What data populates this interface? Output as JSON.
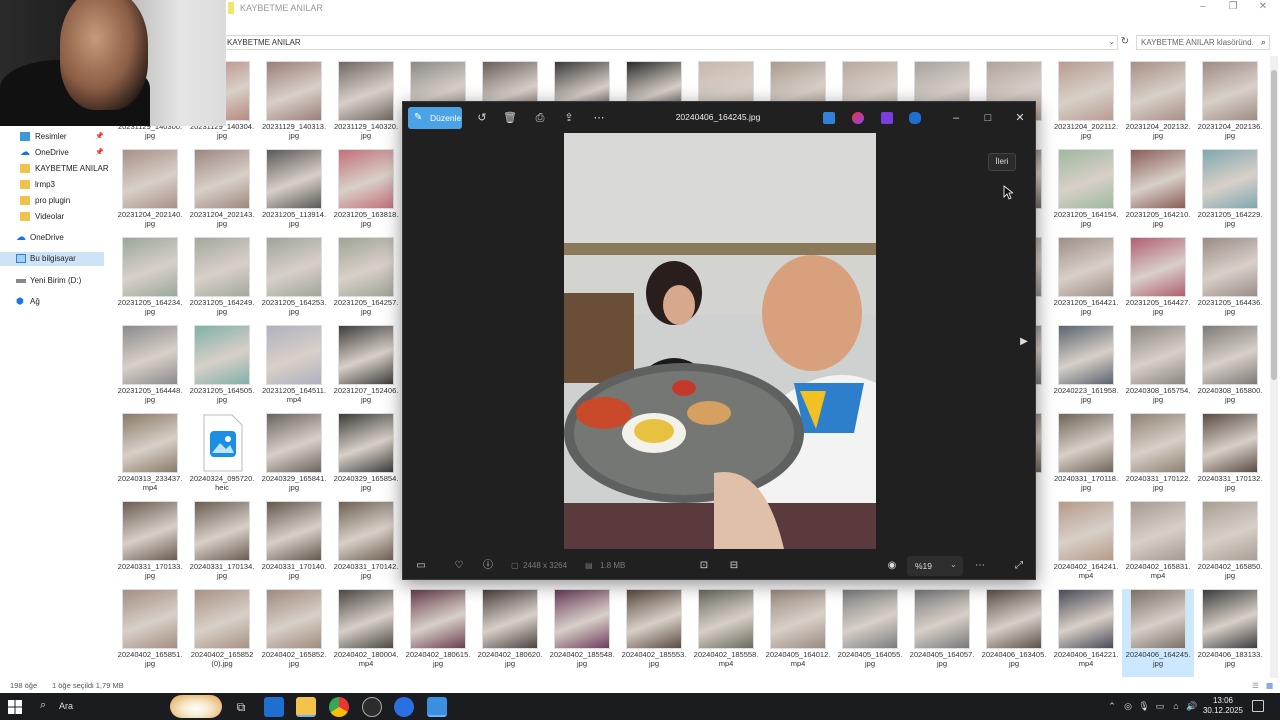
{
  "explorer": {
    "title": "KAYBETME ANILAR",
    "address": "KAYBETME ANILAR",
    "search_placeholder": "KAYBETME ANILAR klasöründ...",
    "status": {
      "count": "198 öğe",
      "selected": "1 öğe seçildi  1,79 MB"
    }
  },
  "sidebar": {
    "items": [
      {
        "label": "Resimler",
        "icon": "pictures-icon"
      },
      {
        "label": "OneDrive",
        "icon": "onedrive-icon"
      },
      {
        "label": "KAYBETME ANILAR",
        "icon": "folder-icon"
      },
      {
        "label": "lrmp3",
        "icon": "folder-icon"
      },
      {
        "label": "pro plugin",
        "icon": "folder-icon"
      },
      {
        "label": "Videolar",
        "icon": "folder-icon"
      },
      {
        "label": "OneDrive",
        "icon": "onedrive-icon"
      },
      {
        "label": "Bu bilgisayar",
        "icon": "this-pc-icon"
      },
      {
        "label": "Yeni Birim (D:)",
        "icon": "drive-icon"
      },
      {
        "label": "Ağ",
        "icon": "network-icon"
      }
    ]
  },
  "files": {
    "row0": [
      {
        "l1": "20231129_140300.",
        "l2": "jpg",
        "c": "#8a7a70"
      },
      {
        "l1": "20231129_140304.",
        "l2": "jpg",
        "c": "#b58a80"
      },
      {
        "l1": "20231129_140313.",
        "l2": "jpg",
        "c": "#9a7f79"
      },
      {
        "l1": "20231129_140320.",
        "l2": "jpg",
        "c": "#6f6763"
      },
      {
        "l1": "",
        "l2": "",
        "c": "#8d8a88"
      },
      {
        "l1": "",
        "l2": "",
        "c": "#6a5e5a"
      },
      {
        "l1": "",
        "l2": "",
        "c": "#3b3838"
      },
      {
        "l1": "",
        "l2": "",
        "c": "#2a2a2a"
      },
      {
        "l1": "",
        "l2": "",
        "c": "#c9b8ae"
      },
      {
        "l1": "",
        "l2": "",
        "c": "#a99b8f"
      },
      {
        "l1": "",
        "l2": "",
        "c": "#b8a89e"
      },
      {
        "l1": "",
        "l2": "",
        "c": "#a8a3a0"
      },
      {
        "l1": "...08.",
        "l2": "",
        "c": "#b0a39c"
      },
      {
        "l1": "20231204_202112.",
        "l2": "jpg",
        "c": "#b89c92"
      },
      {
        "l1": "20231204_202132.",
        "l2": "jpg",
        "c": "#a88f86"
      },
      {
        "l1": "20231204_202136.",
        "l2": "jpg",
        "c": "#9f8b84"
      }
    ],
    "row1": [
      {
        "l1": "20231204_202140.",
        "l2": "jpg",
        "c": "#a89088"
      },
      {
        "l1": "20231204_202143.",
        "l2": "jpg",
        "c": "#9d8780"
      },
      {
        "l1": "20231205_113914.",
        "l2": "jpg",
        "c": "#5b5858"
      },
      {
        "l1": "20231205_163818.",
        "l2": "jpg",
        "c": "#c2707a"
      },
      {
        "l1": "...01.",
        "l2": "",
        "c": "#6f6a60"
      },
      {
        "l1": "20231205_164154.",
        "l2": "jpg",
        "c": "#9fb8a0"
      },
      {
        "l1": "20231205_164210.",
        "l2": "jpg",
        "c": "#8a5d58"
      },
      {
        "l1": "20231205_164229.",
        "l2": "jpg",
        "c": "#7fa8b0"
      }
    ],
    "row2": [
      {
        "l1": "20231205_164234.",
        "l2": "jpg",
        "c": "#9aa79a"
      },
      {
        "l1": "20231205_164249.",
        "l2": "jpg",
        "c": "#a4a89c"
      },
      {
        "l1": "20231205_164253.",
        "l2": "jpg",
        "c": "#a0a499"
      },
      {
        "l1": "20231205_164257.",
        "l2": "jpg",
        "c": "#9fa396"
      },
      {
        "l1": "...58.",
        "l2": "",
        "c": "#909090"
      },
      {
        "l1": "20231205_164421.",
        "l2": "jpg",
        "c": "#9e8e88"
      },
      {
        "l1": "20231205_164427.",
        "l2": "jpg",
        "c": "#b06070"
      },
      {
        "l1": "20231205_164436.",
        "l2": "jpg",
        "c": "#9a8c86"
      }
    ],
    "row3": [
      {
        "l1": "20231205_164448.",
        "l2": "jpg",
        "c": "#8c8a8c"
      },
      {
        "l1": "20231205_164505.",
        "l2": "jpg",
        "c": "#80b0a8"
      },
      {
        "l1": "20231205_164511.",
        "l2": "mp4",
        "c": "#b0b0c0"
      },
      {
        "l1": "20231207_152406.",
        "l2": "jpg",
        "c": "#3e3c3c"
      },
      {
        "l1": "...55.",
        "l2": "",
        "c": "#777"
      },
      {
        "l1": "20240223_161958.",
        "l2": "jpg",
        "c": "#5a6470"
      },
      {
        "l1": "20240308_165754.",
        "l2": "jpg",
        "c": "#8a8680"
      },
      {
        "l1": "20240308_165800.",
        "l2": "jpg",
        "c": "#7e7a78"
      }
    ],
    "row4": [
      {
        "l1": "20240313_233437.",
        "l2": "mp4",
        "c": "#8a7a68"
      },
      {
        "l1": "20240324_095720.",
        "l2": "heic",
        "c": "file"
      },
      {
        "l1": "20240329_165841.",
        "l2": "jpg",
        "c": "#6a6460"
      },
      {
        "l1": "20240329_165854.",
        "l2": "jpg",
        "c": "#3c3c3a"
      },
      {
        "l1": "...11.",
        "l2": "",
        "c": "#6b6350"
      },
      {
        "l1": "20240331_170118.",
        "l2": "jpg",
        "c": "#6e6658"
      },
      {
        "l1": "20240331_170122.",
        "l2": "jpg",
        "c": "#8d8172"
      },
      {
        "l1": "20240331_170132.",
        "l2": "jpg",
        "c": "#5a4c44"
      }
    ],
    "row5": [
      {
        "l1": "20240331_170133.",
        "l2": "jpg",
        "c": "#6a5c52"
      },
      {
        "l1": "20240331_170134.",
        "l2": "jpg",
        "c": "#6a5d53"
      },
      {
        "l1": "20240331_170140.",
        "l2": "jpg",
        "c": "#64584e"
      },
      {
        "l1": "20240331_170142.",
        "l2": "jpg",
        "c": "#6f6155"
      },
      {
        "l1": "20240402_164241.",
        "l2": "mp4",
        "c": "#b59a8a"
      },
      {
        "l1": "20240402_165831.",
        "l2": "mp4",
        "c": "#a69a92"
      },
      {
        "l1": "20240402_165850.",
        "l2": "jpg",
        "c": "#a89e94"
      }
    ],
    "row6": [
      {
        "l1": "20240402_165851.",
        "l2": "jpg",
        "c": "#a48e82"
      },
      {
        "l1": "20240402_165852",
        "l2": "(0).jpg",
        "c": "#a89284"
      },
      {
        "l1": "20240402_165852.",
        "l2": "jpg",
        "c": "#a08a7e"
      },
      {
        "l1": "20240402_180004.",
        "l2": "mp4",
        "c": "#4c4844"
      },
      {
        "l1": "20240402_180615.",
        "l2": "jpg",
        "c": "#6a3e4e"
      },
      {
        "l1": "20240402_180620.",
        "l2": "jpg",
        "c": "#4a4240"
      },
      {
        "l1": "20240402_185548.",
        "l2": "jpg",
        "c": "#6c3c5c"
      },
      {
        "l1": "20240402_185553.",
        "l2": "jpg",
        "c": "#5a4a40"
      },
      {
        "l1": "20240402_185558.",
        "l2": "mp4",
        "c": "#6a6a5c"
      },
      {
        "l1": "20240405_164012.",
        "l2": "mp4",
        "c": "#9a8a80"
      },
      {
        "l1": "20240405_164055.",
        "l2": "jpg",
        "c": "#7c7c7e"
      },
      {
        "l1": "20240405_164057.",
        "l2": "jpg",
        "c": "#78787a"
      },
      {
        "l1": "20240406_163405.",
        "l2": "jpg",
        "c": "#5a5048"
      },
      {
        "l1": "20240406_164221.",
        "l2": "mp4",
        "c": "#4a4a58"
      },
      {
        "l1": "20240406_164245.",
        "l2": "jpg",
        "c": "#7a7068"
      },
      {
        "l1": "20240406_183133.",
        "l2": "jpg",
        "c": "#3c3c3e"
      }
    ]
  },
  "viewer": {
    "edit_label": "Düzenle",
    "filename": "20240406_164245.jpg",
    "dimensions": "2448 x 3264",
    "filesize": "1.8 MB",
    "zoom": "%19",
    "tooltip": "İleri"
  },
  "taskbar": {
    "search_label": "Ara",
    "time": "13:06",
    "date": "30.12.2025"
  }
}
